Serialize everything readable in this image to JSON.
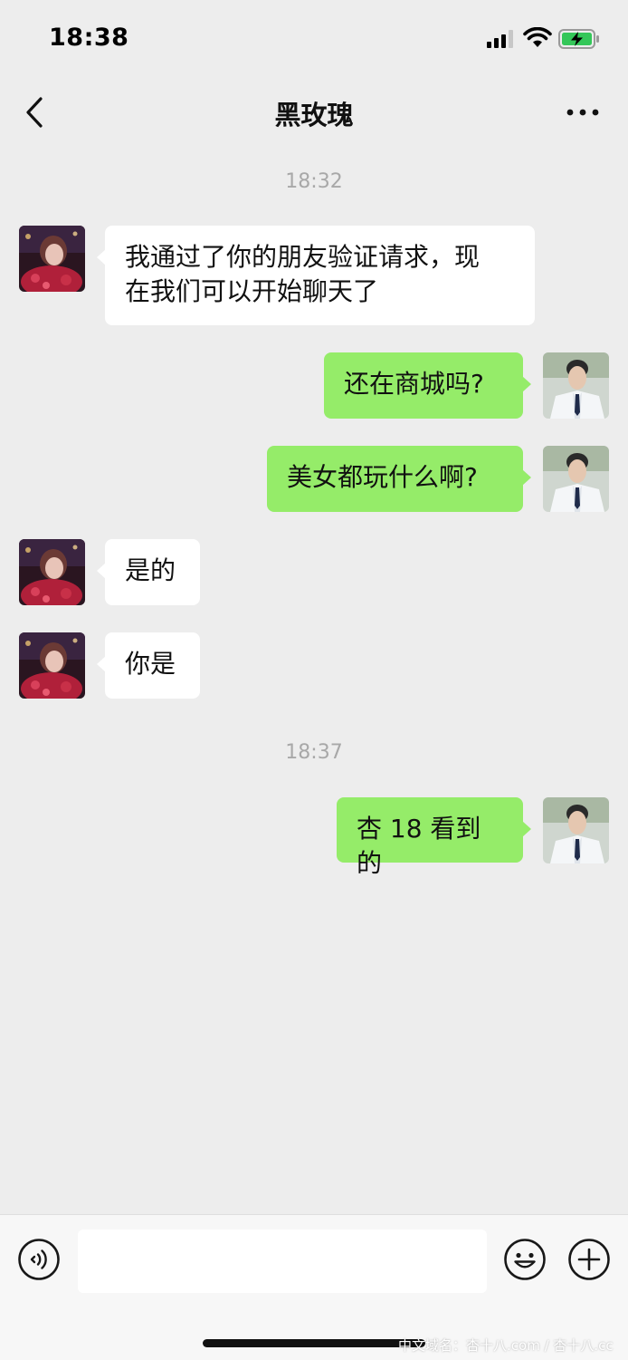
{
  "status_bar": {
    "time": "18:38",
    "icons": [
      "cellular-signal-icon",
      "wifi-icon",
      "battery-charging-icon"
    ],
    "battery_color": "#34c759"
  },
  "nav": {
    "title": "黑玫瑰",
    "back_icon": "chevron-left-icon",
    "more_icon": "ellipsis-icon"
  },
  "chat": {
    "timestamps": [
      "18:32",
      "18:37"
    ],
    "messages": [
      {
        "side": "received",
        "text": "我通过了你的朋友验证请求，现在我们可以开始聊天了",
        "line1": "我通过了你的朋友验证请求，现",
        "line2": "在我们可以开始聊天了"
      },
      {
        "side": "sent",
        "text": "还在商城吗?"
      },
      {
        "side": "sent",
        "text": "美女都玩什么啊?"
      },
      {
        "side": "received",
        "text": "是的"
      },
      {
        "side": "received",
        "text": "你是"
      },
      {
        "side": "sent",
        "text": "杏 18 看到的"
      }
    ],
    "sent_bubble_color": "#95ec69",
    "received_bubble_color": "#ffffff",
    "background_color": "#ededed"
  },
  "input_bar": {
    "value": "",
    "icons": [
      "voice-icon",
      "emoji-icon",
      "plus-icon"
    ]
  },
  "watermark": "中文域名：杏十八.com / 杏十八.cc"
}
